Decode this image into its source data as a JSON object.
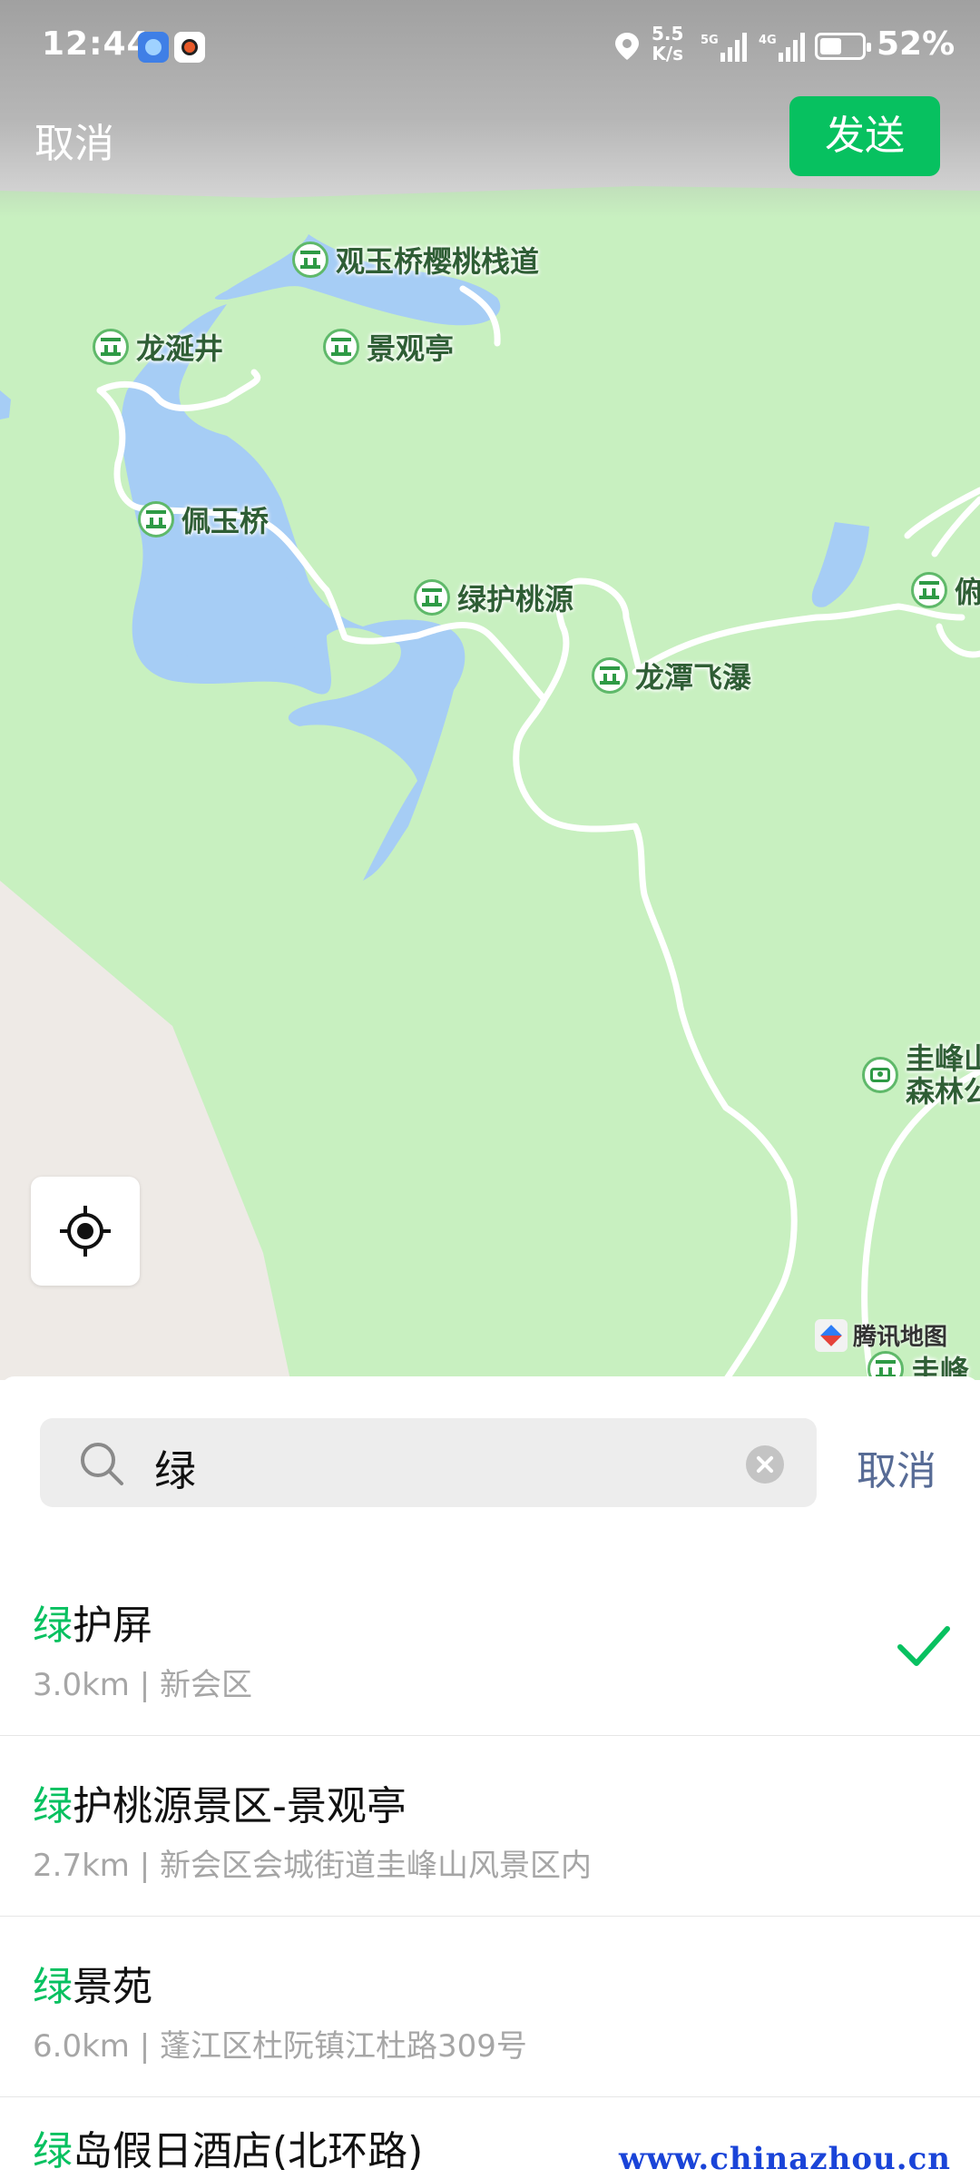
{
  "status_bar": {
    "time": "12:44",
    "net_speed_value": "5.5",
    "net_speed_unit": "K/s",
    "signal_5g": "5G",
    "signal_4g": "4G",
    "battery_percent_text": "52%",
    "battery_level": 0.52,
    "icons": [
      "app-blue-icon",
      "app-fox-icon",
      "location-icon",
      "signal-5g-icon",
      "signal-4g-icon",
      "battery-icon"
    ]
  },
  "header": {
    "cancel_label": "取消",
    "send_label": "发送",
    "send_color": "#07c160"
  },
  "map": {
    "pois": [
      {
        "name": "观玉桥樱桃栈道",
        "icon": "scenic-spot-icon"
      },
      {
        "name": "龙涎井",
        "icon": "scenic-spot-icon"
      },
      {
        "name": "景观亭",
        "icon": "scenic-spot-icon"
      },
      {
        "name": "佩玉桥",
        "icon": "scenic-spot-icon"
      },
      {
        "name": "绿护桃源",
        "icon": "scenic-spot-icon"
      },
      {
        "name": "龙潭飞瀑",
        "icon": "scenic-spot-icon"
      },
      {
        "name": "俯",
        "icon": "scenic-spot-icon"
      },
      {
        "name": "圭峰山",
        "icon": "camera-spot-icon"
      },
      {
        "name": "森林公",
        "icon": "camera-spot-icon"
      },
      {
        "name": "圭峰",
        "icon": "scenic-spot-icon"
      }
    ],
    "brand_label": "腾讯地图",
    "colors": {
      "land": "#c8f0c0",
      "water": "#a6cdf5",
      "urban": "#eeeae6",
      "road": "#ffffff"
    }
  },
  "search": {
    "query": "绿",
    "cancel_label": "取消"
  },
  "results": [
    {
      "highlight": "绿",
      "rest": "护屏",
      "distance": "3.0km",
      "separator": "|",
      "address": "新会区",
      "selected": true
    },
    {
      "highlight": "绿",
      "rest": "护桃源景区-景观亭",
      "distance": "2.7km",
      "separator": "|",
      "address": "新会区会城街道圭峰山风景区内",
      "selected": false
    },
    {
      "highlight": "绿",
      "rest": "景苑",
      "distance": "6.0km",
      "separator": "|",
      "address": "蓬江区杜阮镇江杜路309号",
      "selected": false
    },
    {
      "highlight": "绿",
      "rest": "岛假日酒店(北环路)",
      "distance": "",
      "separator": "",
      "address": "",
      "selected": false
    }
  ],
  "watermark": "www.chinazhou.cn",
  "accent_color": "#07c160"
}
